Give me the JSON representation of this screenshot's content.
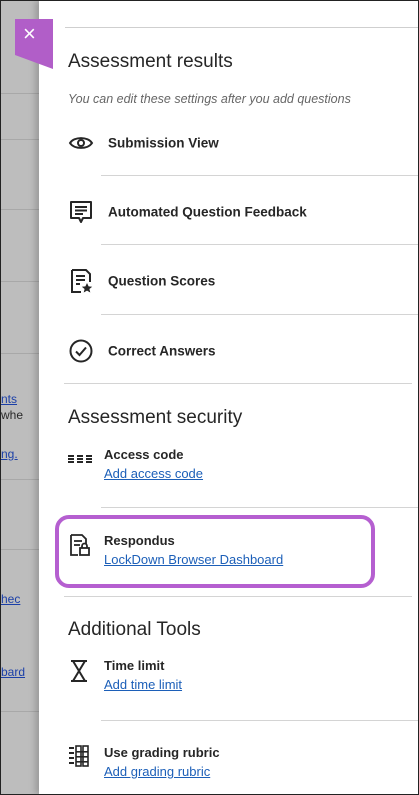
{
  "background": {
    "fragments": [
      {
        "text": "nts",
        "link": true
      },
      {
        "text": "whe",
        "link": false
      },
      {
        "text": "ng.",
        "link": true
      },
      {
        "text": "hec",
        "link": true
      },
      {
        "text": "bard",
        "link": true
      }
    ]
  },
  "close_label": "×",
  "assessment_results": {
    "title": "Assessment results",
    "hint": "You can edit these settings after you add questions",
    "items": [
      {
        "label": "Submission View",
        "icon": "eye-icon"
      },
      {
        "label": "Automated Question Feedback",
        "icon": "feedback-icon"
      },
      {
        "label": "Question Scores",
        "icon": "scores-icon"
      },
      {
        "label": "Correct Answers",
        "icon": "check-circle-icon"
      }
    ]
  },
  "assessment_security": {
    "title": "Assessment security",
    "access_code": {
      "title": "Access code",
      "link": "Add access code",
      "icon": "asterisks-icon"
    },
    "respondus": {
      "title": "Respondus",
      "link": "LockDown Browser Dashboard",
      "icon": "lockdown-doc-icon"
    }
  },
  "additional_tools": {
    "title": "Additional Tools",
    "time_limit": {
      "title": "Time limit",
      "link": "Add time limit",
      "icon": "hourglass-icon"
    },
    "grading_rubric": {
      "title": "Use grading rubric",
      "link": "Add grading rubric",
      "icon": "rubric-icon"
    }
  },
  "colors": {
    "highlight": "#b55fd0",
    "link": "#1c5fb8",
    "close": "#b15ec8"
  }
}
